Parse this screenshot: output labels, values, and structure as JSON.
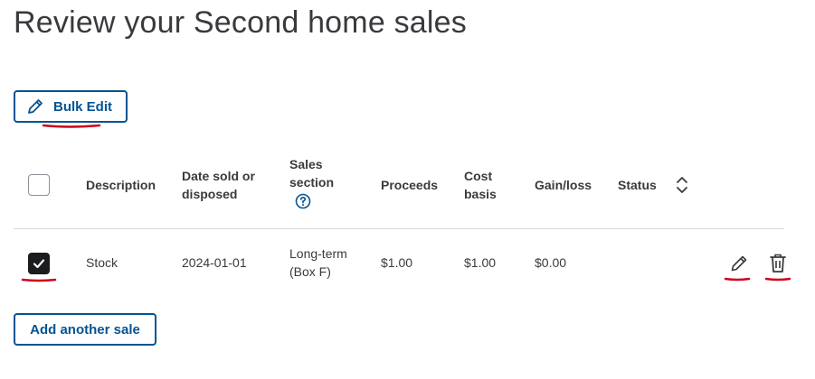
{
  "page": {
    "title": "Review your Second home sales"
  },
  "toolbar": {
    "bulk_edit_label": "Bulk Edit"
  },
  "table": {
    "headers": {
      "description": "Description",
      "date_line1": "Date sold or",
      "date_line2": "disposed",
      "section_line1": "Sales",
      "section_line2": "section",
      "proceeds": "Proceeds",
      "cost_line1": "Cost",
      "cost_line2": "basis",
      "gain": "Gain/loss",
      "status": "Status"
    },
    "rows": [
      {
        "checked": true,
        "description": "Stock",
        "date": "2024-01-01",
        "section_line1": "Long-term",
        "section_line2": "(Box F)",
        "proceeds": "$1.00",
        "cost_basis": "$1.00",
        "gain_loss": "$0.00",
        "status": ""
      }
    ]
  },
  "actions": {
    "add_sale_label": "Add another sale"
  },
  "colors": {
    "primary": "#055393",
    "text": "#393a3d",
    "annotation": "#d0021b",
    "divider": "#d4d7dc"
  },
  "icons": [
    "pencil-icon",
    "help-circle-icon",
    "sort-icon",
    "check-icon",
    "trash-icon"
  ]
}
